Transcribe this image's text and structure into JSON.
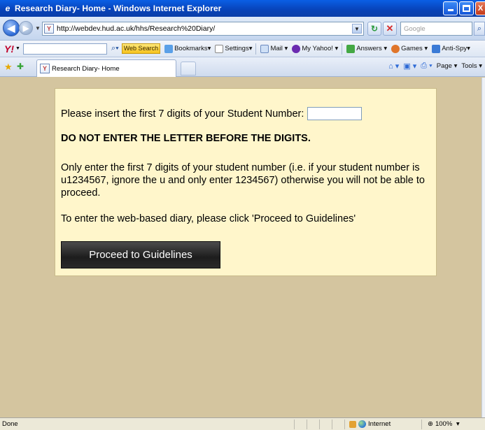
{
  "window": {
    "title": "Research Diary- Home - Windows Internet Explorer",
    "minimize": "_",
    "maximize": "□",
    "close": "X"
  },
  "address_bar": {
    "url": "http://webdev.hud.ac.uk/hhs/Research%20Diary/",
    "search_placeholder": "Google"
  },
  "yahoo_toolbar": {
    "logo": "Y!",
    "search_button": "Web Search",
    "items": [
      "Bookmarks",
      "Settings",
      "Mail",
      "My Yahoo!",
      "Answers",
      "Games",
      "Anti-Spy"
    ]
  },
  "tabs": {
    "active_tab": "Research Diary- Home",
    "commands": [
      "Page",
      "Tools"
    ]
  },
  "page": {
    "prompt": "Please insert the first 7 digits of your Student Number:",
    "warning": "DO NOT ENTER THE LETTER BEFORE THE DIGITS.",
    "instructions": "Only enter the first 7 digits of your student number (i.e. if your student number is u1234567, ignore the u and only enter 1234567) otherwise you will not be able to proceed.",
    "proceed_hint": "To enter the web-based diary, please click 'Proceed to Guidelines'",
    "student_number_value": "",
    "proceed_button": "Proceed to Guidelines"
  },
  "status_bar": {
    "status": "Done",
    "zone": "Internet",
    "zoom": "100%"
  },
  "colors": {
    "page_background": "#d4c59f",
    "panel_background": "#fff6cb",
    "button_background": "#2a2a2a",
    "titlebar": "#0842b8"
  },
  "icons": [
    "ie-logo-icon",
    "back-icon",
    "forward-icon",
    "page-icon",
    "refresh-icon",
    "stop-icon",
    "search-icon",
    "favorites-star-icon",
    "add-favorites-icon",
    "home-icon",
    "feeds-icon",
    "print-icon",
    "globe-icon"
  ]
}
